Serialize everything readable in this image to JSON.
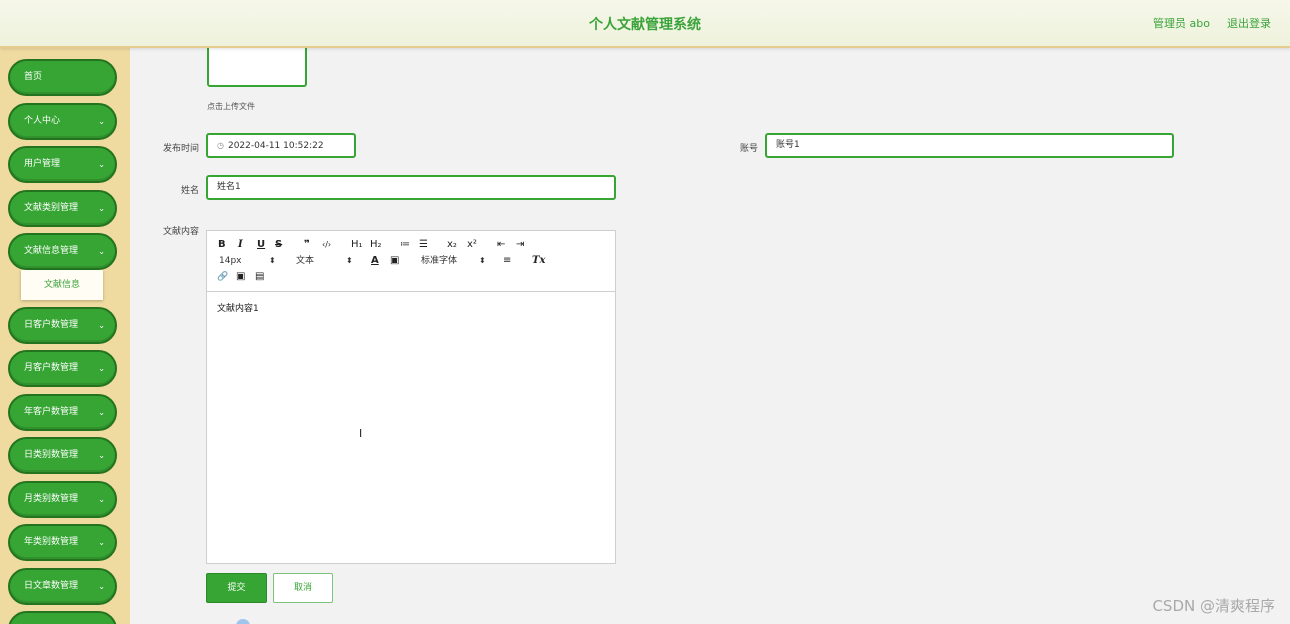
{
  "header": {
    "title": "个人文献管理系统",
    "user": "管理员 abo",
    "logout": "退出登录"
  },
  "sidebar": {
    "items": [
      {
        "label": "首页",
        "expandable": false
      },
      {
        "label": "个人中心",
        "expandable": true
      },
      {
        "label": "用户管理",
        "expandable": true
      },
      {
        "label": "文献类别管理",
        "expandable": true
      },
      {
        "label": "文献信息管理",
        "expandable": true
      },
      {
        "label": "日客户数管理",
        "expandable": true
      },
      {
        "label": "月客户数管理",
        "expandable": true
      },
      {
        "label": "年客户数管理",
        "expandable": true
      },
      {
        "label": "日类别数管理",
        "expandable": true
      },
      {
        "label": "月类别数管理",
        "expandable": true
      },
      {
        "label": "年类别数管理",
        "expandable": true
      },
      {
        "label": "日文章数管理",
        "expandable": true
      }
    ],
    "submenu": {
      "label": "文献信息"
    }
  },
  "form": {
    "upload_hint": "点击上传文件",
    "publish_time_label": "发布时间",
    "publish_time_value": "2022-04-11 10:52:22",
    "account_label": "账号",
    "account_value": "账号1",
    "name_label": "姓名",
    "name_value": "姓名1",
    "content_label": "文献内容",
    "content_value": "文献内容1",
    "submit": "提交",
    "cancel": "取消"
  },
  "editor_toolbar": {
    "bold": "B",
    "italic": "I",
    "underline": "U",
    "strike": "S",
    "quote": "❞",
    "code": "‹/›",
    "h1": "H₁",
    "h2": "H₂",
    "ordered_list": "≔",
    "bullet_list": "☰",
    "subscript": "x₂",
    "superscript": "x²",
    "outdent": "⇤",
    "indent": "⇥",
    "size": "14px",
    "format": "文本",
    "color": "A",
    "background": "▣",
    "font": "标准字体",
    "align": "≡",
    "clean": "Tx",
    "link": "🔗",
    "image": "▣",
    "video": "▤"
  },
  "watermark": "CSDN @清爽程序"
}
